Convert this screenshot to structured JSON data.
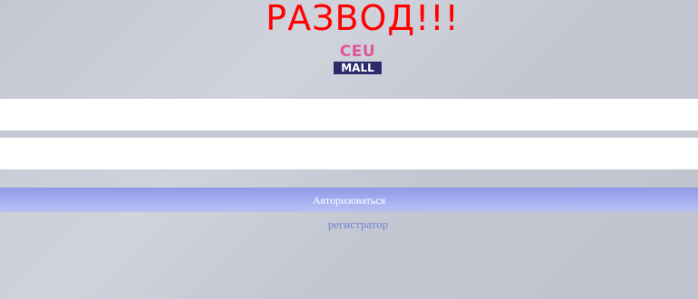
{
  "header": {
    "warning_text": "РАЗВОД!!!"
  },
  "logo": {
    "top_text": "CEU",
    "bottom_text": "MALL"
  },
  "form": {
    "login_value": "",
    "password_value": "",
    "submit_label": "Авторизоваться",
    "register_label": "регистратор"
  },
  "colors": {
    "warning": "#ff0000",
    "logo_pink": "#e0559a",
    "logo_navy": "#2b2b6b",
    "button": "#9aa4ee",
    "link": "#7583d6"
  }
}
